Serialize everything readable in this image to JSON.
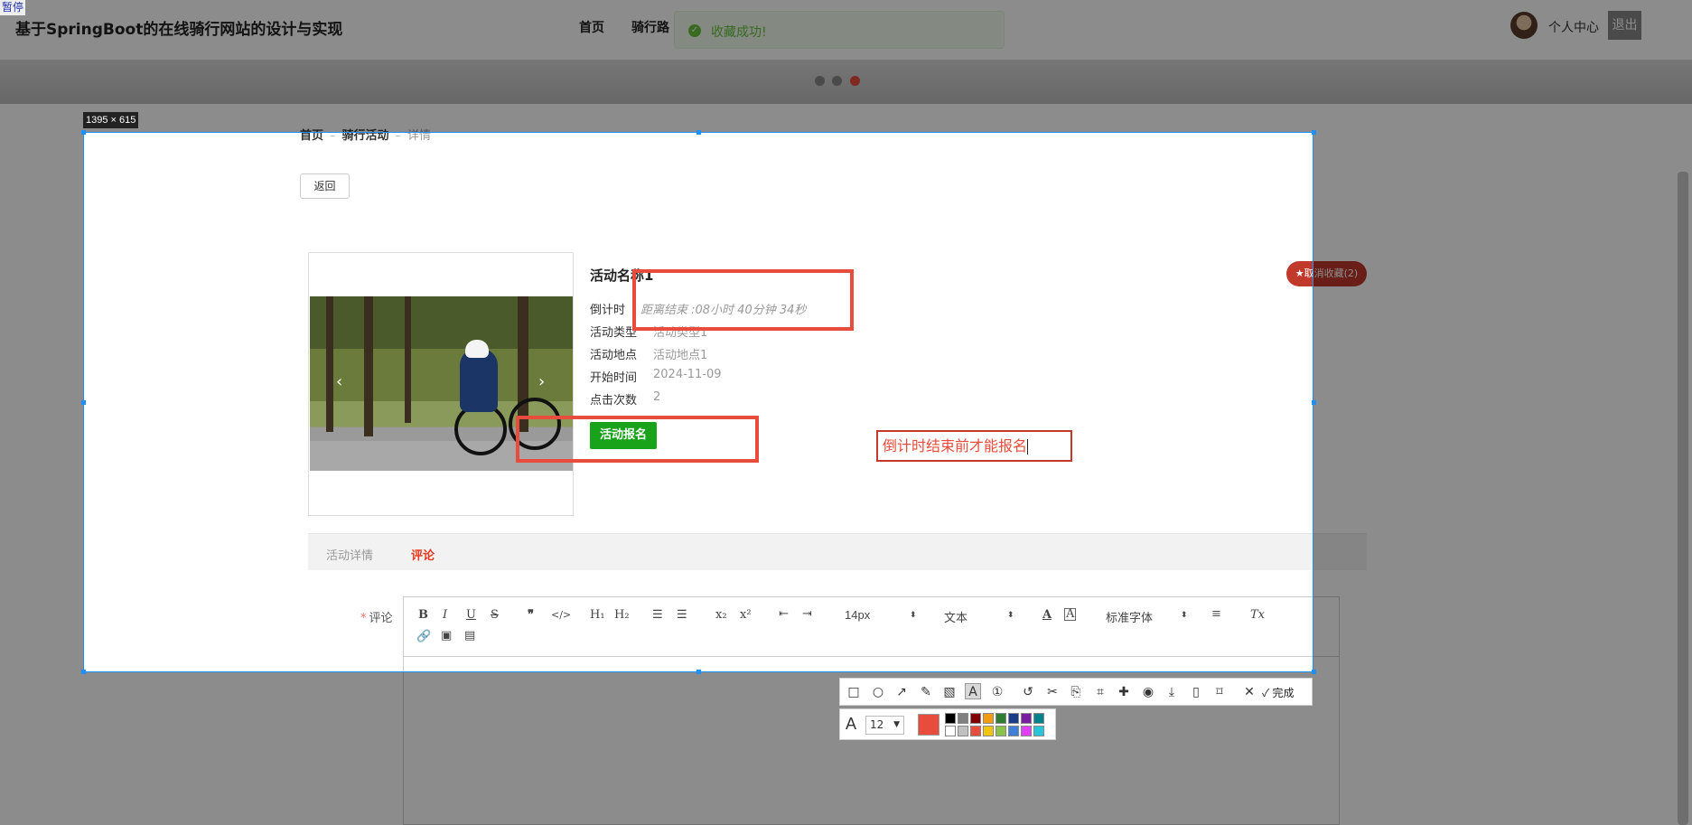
{
  "corner_tag": "暂停",
  "site": {
    "title": "基于SpringBoot的在线骑行网站的设计与实现",
    "nav": [
      "首页",
      "骑行路"
    ],
    "user_center": "个人中心",
    "logout": "退出"
  },
  "toast": {
    "text": "收藏成功!"
  },
  "breadcrumb": {
    "home": "首页",
    "section": "骑行活动",
    "current": "详情"
  },
  "back_label": "返回",
  "activity": {
    "name": "活动名称1",
    "rows": [
      {
        "label": "倒计时",
        "value": "距离结束 :08小时 40分钟 34秒"
      },
      {
        "label": "活动类型",
        "value": "活动类型1"
      },
      {
        "label": "活动地点",
        "value": "活动地点1"
      },
      {
        "label": "开始时间",
        "value": "2024-11-09"
      },
      {
        "label": "点击次数",
        "value": "2"
      }
    ],
    "signup_label": "活动报名",
    "favorite_label": "★取消收藏(2)"
  },
  "tabs": [
    {
      "label": "活动详情",
      "active": false
    },
    {
      "label": "评论",
      "active": true
    }
  ],
  "comment": {
    "required_mark": "*",
    "label": "评论",
    "toolbar": {
      "bold": "B",
      "italic": "I",
      "underline": "U",
      "strike": "S",
      "quote": "❞",
      "code": "</>",
      "h1": "H₁",
      "h2": "H₂",
      "ordered": "☰",
      "bullet": "☰",
      "sub": "x₂",
      "sup": "x²",
      "indent_less": "⇤",
      "indent_more": "⇥",
      "size": "14px",
      "block": "文本",
      "font": "标准字体",
      "align": "≡",
      "clear": "Tx"
    }
  },
  "capture": {
    "size_label": "1395 × 615",
    "annotation_text": "倒计时结束前才能报名",
    "done_label": "完成",
    "font_size": "12",
    "current_color": "#e74c3c",
    "palette": [
      "#000000",
      "#808080",
      "#800000",
      "#f39c12",
      "#2e7d32",
      "#1a3a8a",
      "#7b1fa2",
      "#00838f",
      "#ffffff",
      "#c0c0c0",
      "#e74c3c",
      "#f1c40f",
      "#8bc34a",
      "#3f7fd8",
      "#e040fb",
      "#26c6da"
    ]
  }
}
